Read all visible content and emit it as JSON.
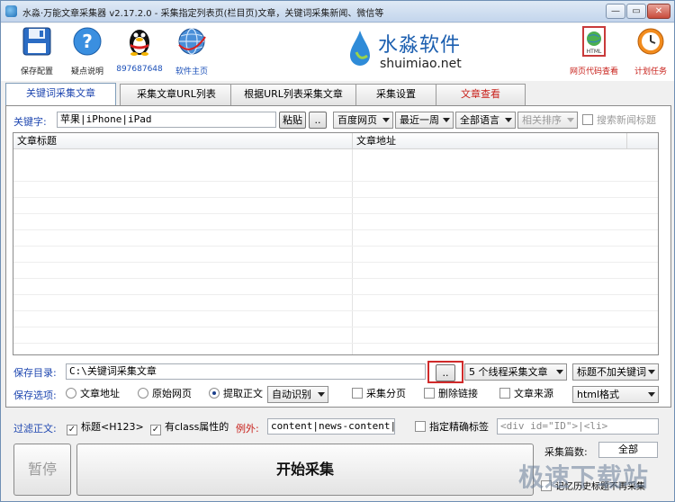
{
  "window": {
    "title": "水淼·万能文章采集器 v2.17.2.0 - 采集指定列表页(栏目页)文章，关键词采集新闻、微信等",
    "min": "—",
    "max": "▭",
    "close": "✕"
  },
  "toolbar": {
    "save_config": "保存配置",
    "help": "疑点说明",
    "qq": "897687648",
    "homepage": "软件主页",
    "logo_cn": "水淼软件",
    "logo_en": "shuimiao.net",
    "html_view": "网页代码查看",
    "schedule": "计划任务",
    "html_icon_text": "HTML"
  },
  "tabs": [
    {
      "label": "关键词采集文章"
    },
    {
      "label": "采集文章URL列表"
    },
    {
      "label": "根据URL列表采集文章"
    },
    {
      "label": "采集设置"
    },
    {
      "label": "文章查看"
    }
  ],
  "keyword": {
    "label": "关键字:",
    "value": "苹果|iPhone|iPad",
    "paste": "粘贴",
    "more": "..",
    "engine": "百度网页",
    "period": "最近一周",
    "language": "全部语言",
    "sort": "相关排序",
    "search_news": "搜索新闻标题"
  },
  "list": {
    "col_title": "文章标题",
    "col_url": "文章地址"
  },
  "save": {
    "dir_label": "保存目录:",
    "dir_value": "C:\\关键词采集文章",
    "browse": "..",
    "threads": "5 个线程采集文章",
    "title_mode": "标题不加关键词"
  },
  "options": {
    "label": "保存选项:",
    "radio_url": "文章地址",
    "radio_raw": "原始网页",
    "radio_extract": "提取正文",
    "auto": "自动识别",
    "paging": "采集分页",
    "remove_links": "删除链接",
    "source": "文章来源",
    "format": "html格式"
  },
  "filter": {
    "label": "过滤正文:",
    "title_h123": "标题<H123>",
    "has_class": "有class属性的",
    "example_label": "例外:",
    "example_value": "content|news-content|abs",
    "precise_tag": "指定精确标签",
    "precise_value": "<div id=\"ID\">|<li>"
  },
  "bottom": {
    "pause": "暂停",
    "start": "开始采集",
    "count_label": "采集篇数:",
    "count_value": "全部",
    "history": "记忆历史标题不再采集",
    "watermark": "极速下载站"
  },
  "colors": {
    "accent": "#1f47b0",
    "red": "#c8201a"
  }
}
